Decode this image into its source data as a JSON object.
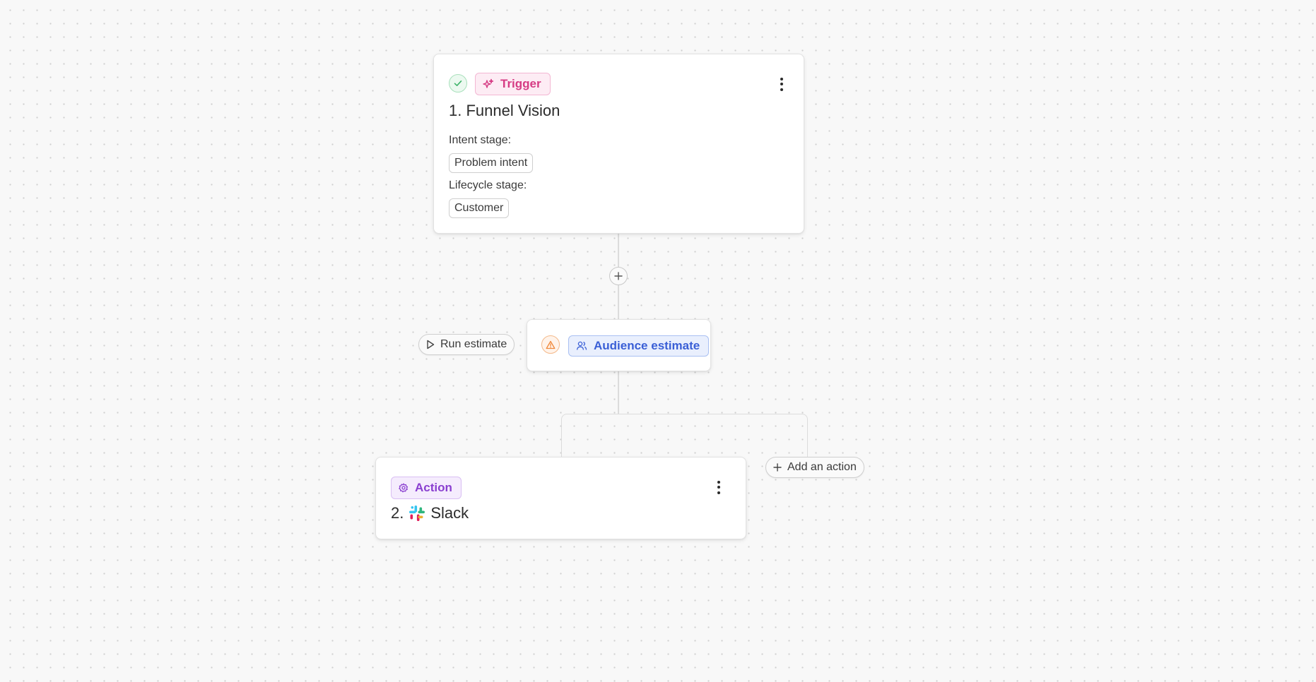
{
  "trigger_card": {
    "tag_label": "Trigger",
    "title": "1. Funnel Vision",
    "intent_label": "Intent stage:",
    "intent_value": "Problem intent",
    "lifecycle_label": "Lifecycle stage:",
    "lifecycle_value": "Customer",
    "status": "complete"
  },
  "audience_card": {
    "tag_label": "Audience estimate",
    "status": "warning",
    "run_button_label": "Run estimate"
  },
  "action_card": {
    "tag_label": "Action",
    "title_prefix": "2.",
    "title_name": "Slack",
    "add_action_label": "Add an action"
  },
  "icons": {
    "trigger_status": "check-icon",
    "trigger_tag": "sparkles-icon",
    "audience_status": "warning-triangle-icon",
    "audience_tag": "users-icon",
    "action_tag": "gear-icon",
    "slack": "slack-logo-icon",
    "run": "play-icon",
    "add": "plus-icon",
    "menu": "kebab-menu-icon"
  },
  "colors": {
    "trigger_accent": "#d63c84",
    "action_accent": "#8a3fd0",
    "audience_accent": "#3a5fd6",
    "success": "#3fb36a",
    "warning": "#f0883a"
  }
}
